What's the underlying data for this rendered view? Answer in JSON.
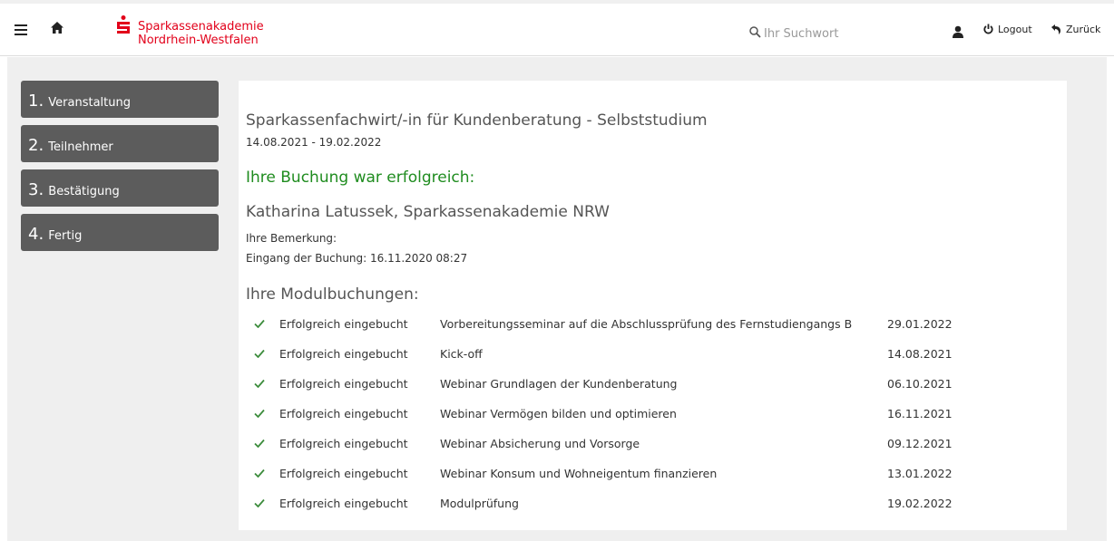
{
  "header": {
    "logo_line1": "Sparkassenakademie",
    "logo_line2": "Nordrhein-Westfalen",
    "search_placeholder": "Ihr Suchwort",
    "logout_label": "Logout",
    "back_label": "Zurück",
    "icons": [
      "menu-icon",
      "home-icon",
      "sparkasse-s-logo-icon",
      "search-icon",
      "user-icon",
      "power-icon",
      "back-arrow-icon"
    ]
  },
  "steps": [
    {
      "num": "1.",
      "label": "Veranstaltung"
    },
    {
      "num": "2.",
      "label": "Teilnehmer"
    },
    {
      "num": "3.",
      "label": "Bestätigung"
    },
    {
      "num": "4.",
      "label": "Fertig"
    }
  ],
  "event": {
    "title": "Sparkassenfachwirt/-in für Kundenberatung - Selbststudium",
    "dates": "14.08.2021 - 19.02.2022"
  },
  "booking": {
    "success_message": "Ihre Buchung war erfolgreich:",
    "person": "Katharina Latussek, Sparkassenakademie NRW",
    "remark_label": "Ihre Bemerkung:",
    "received": "Eingang der Buchung: 16.11.2020 08:27"
  },
  "modules": {
    "heading": "Ihre Modulbuchungen:",
    "rows": [
      {
        "status": "Erfolgreich eingebucht",
        "name": "Vorbereitungsseminar auf die Abschlussprüfung des Fernstudiengangs B",
        "date": "29.01.2022"
      },
      {
        "status": "Erfolgreich eingebucht",
        "name": "Kick-off",
        "date": "14.08.2021"
      },
      {
        "status": "Erfolgreich eingebucht",
        "name": "Webinar Grundlagen der Kundenberatung",
        "date": "06.10.2021"
      },
      {
        "status": "Erfolgreich eingebucht",
        "name": "Webinar Vermögen bilden und optimieren",
        "date": "16.11.2021"
      },
      {
        "status": "Erfolgreich eingebucht",
        "name": "Webinar Absicherung und Vorsorge",
        "date": "09.12.2021"
      },
      {
        "status": "Erfolgreich eingebucht",
        "name": "Webinar Konsum und Wohneigentum finanzieren",
        "date": "13.01.2022"
      },
      {
        "status": "Erfolgreich eingebucht",
        "name": "Modulprüfung",
        "date": "19.02.2022"
      }
    ]
  },
  "colors": {
    "brand_red": "#e2001a",
    "success_green": "#1f8c1f",
    "step_bg": "#5c5c5c",
    "page_bg": "#efefef"
  }
}
